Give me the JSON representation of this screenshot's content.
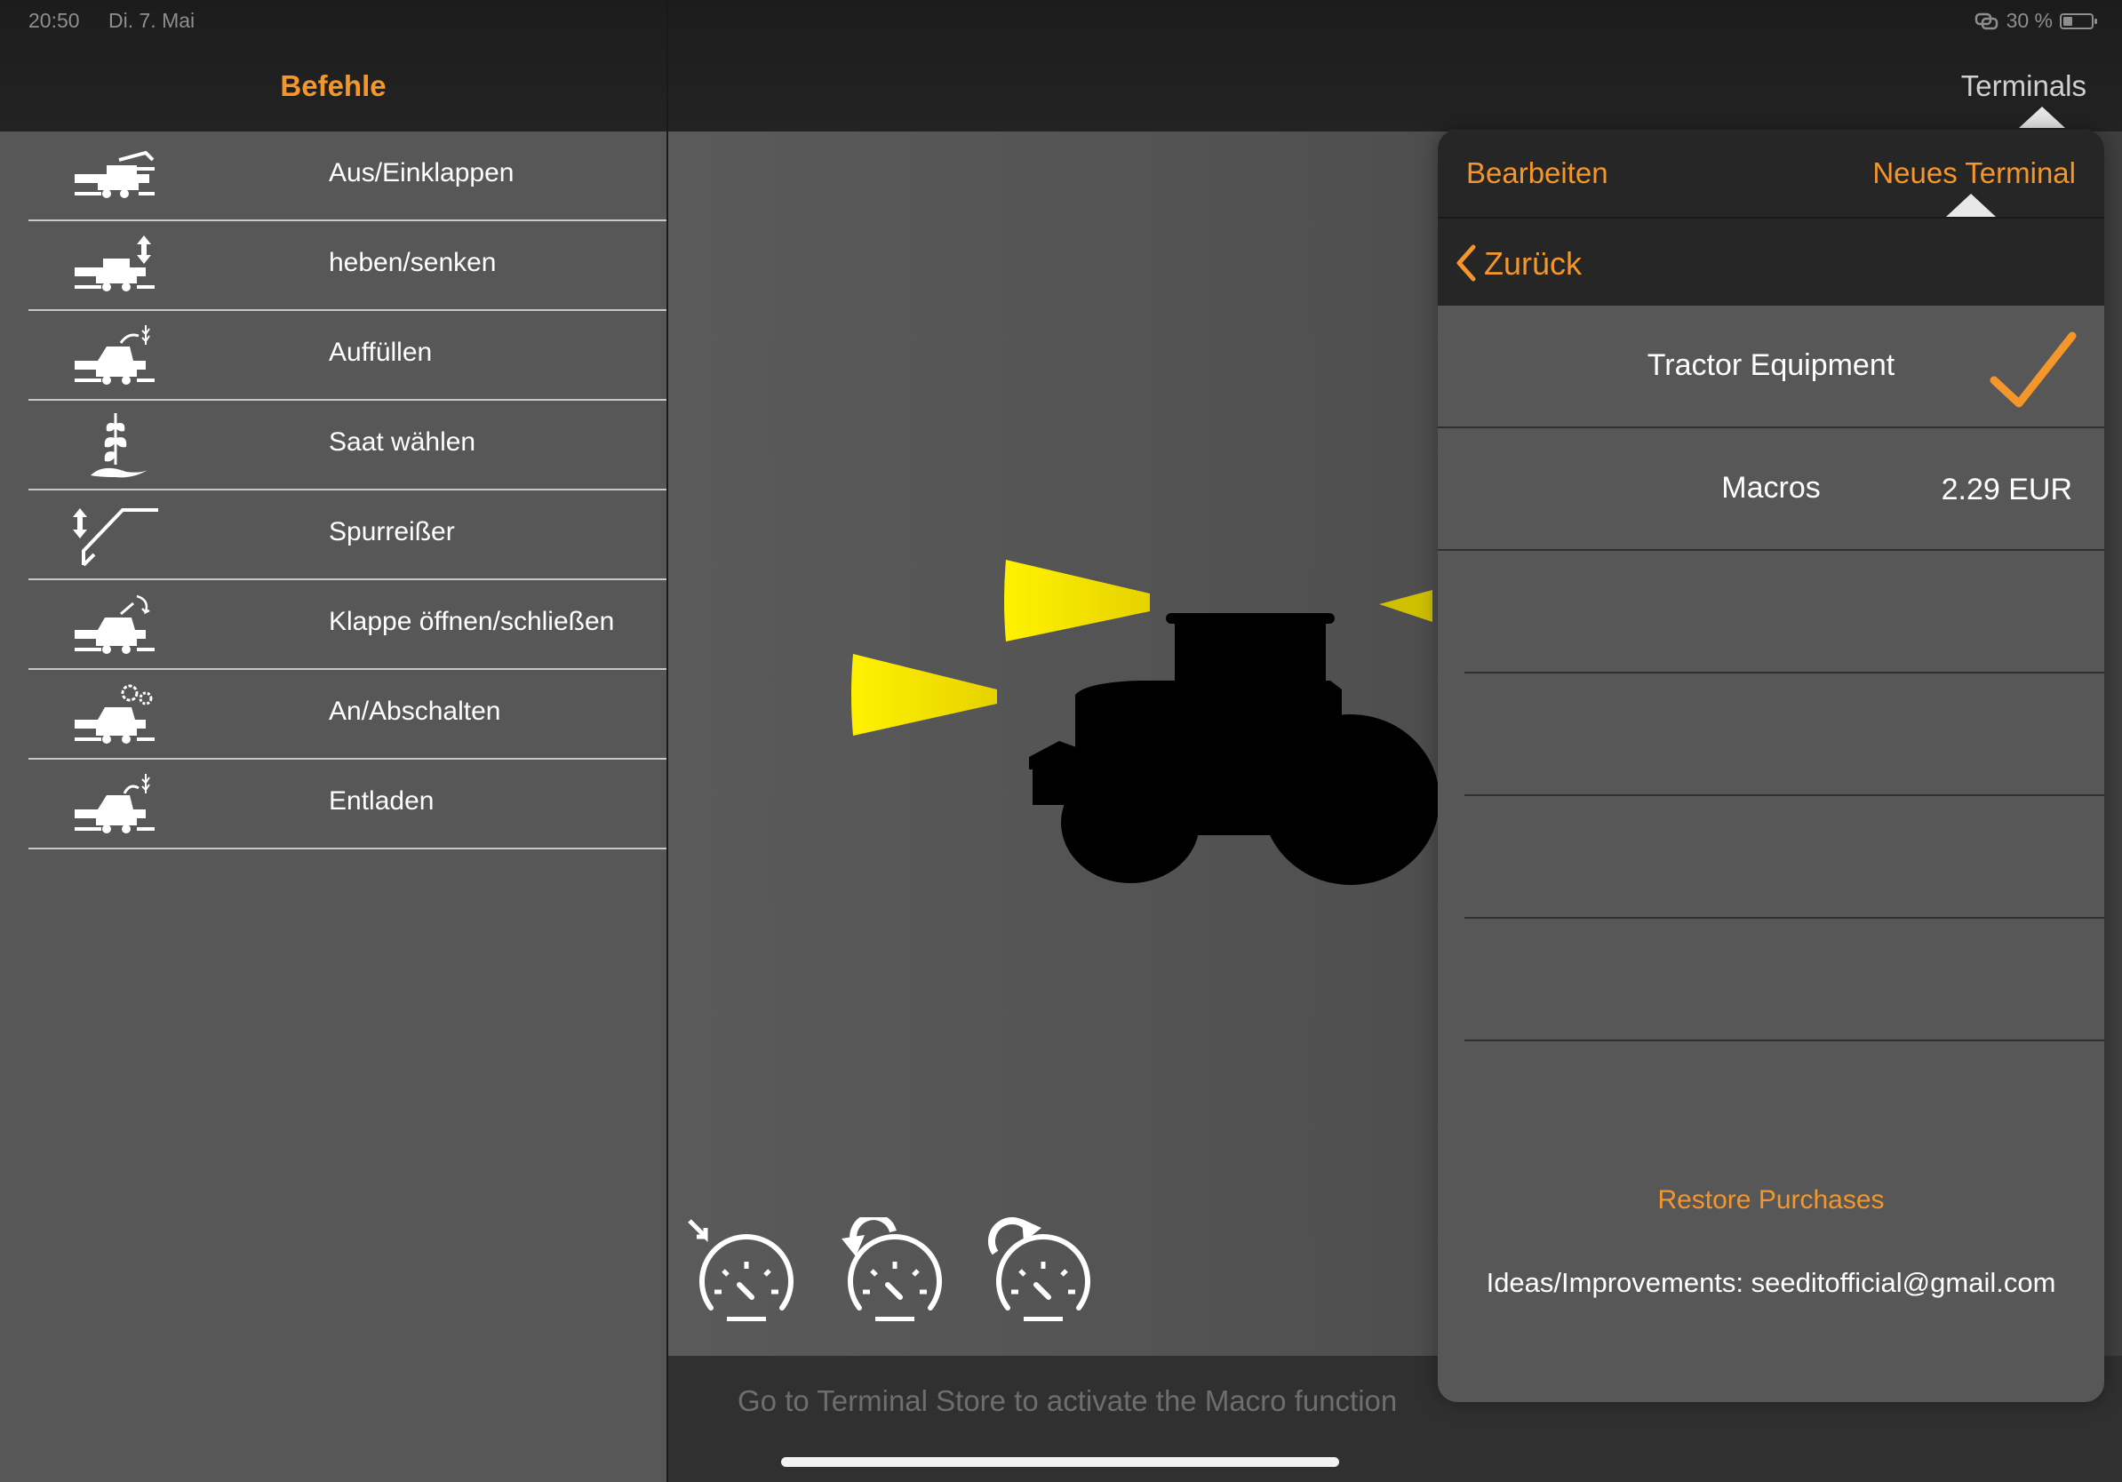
{
  "status": {
    "time": "20:50",
    "date": "Di. 7. Mai",
    "battery": "30 %",
    "battery_level": 0.3
  },
  "sidebar": {
    "title": "Befehle",
    "items": [
      {
        "label": "Aus/Einklappen",
        "icon": "fold-machine-icon"
      },
      {
        "label": "heben/senken",
        "icon": "raise-lower-icon"
      },
      {
        "label": "Auffüllen",
        "icon": "refill-icon"
      },
      {
        "label": "Saat wählen",
        "icon": "seed-select-icon"
      },
      {
        "label": "Spurreißer",
        "icon": "track-marker-icon"
      },
      {
        "label": "Klappe öffnen/schließen",
        "icon": "flap-toggle-icon"
      },
      {
        "label": "An/Abschalten",
        "icon": "power-gears-icon"
      },
      {
        "label": "Entladen",
        "icon": "unload-icon"
      }
    ]
  },
  "main": {
    "terminals_label": "Terminals",
    "footer_message": "Go to Terminal Store to activate the Macro function",
    "gauges": [
      "speed-reset-icon",
      "speed-decrease-icon",
      "speed-increase-icon"
    ]
  },
  "popover": {
    "edit_label": "Bearbeiten",
    "new_label": "Neues Terminal",
    "back_label": "Zurück",
    "items": [
      {
        "name": "Tractor Equipment",
        "purchased": true,
        "price": ""
      },
      {
        "name": "Macros",
        "purchased": false,
        "price": "2.29 EUR"
      }
    ],
    "restore_label": "Restore Purchases",
    "ideas_text": "Ideas/Improvements: seeditofficial@gmail.com"
  },
  "colors": {
    "accent": "#f4962a",
    "light_beam": "#ffe600",
    "panel": "#575757",
    "header": "#1e1e1e"
  }
}
